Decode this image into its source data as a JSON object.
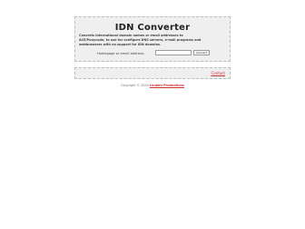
{
  "main": {
    "title": "IDN Converter",
    "description": "Converts international domain names or email addresses to\nACE/Punycode, to use for configure DNS servers, e-mail programs and\nwebbrowsers with no support for IDN domains.",
    "input_label": "Homepage or email address:",
    "input_value": "",
    "button_label": "Convert"
  },
  "footer": {
    "link_label": "Contact"
  },
  "copyright": {
    "prefix": "Copyright © 2004 ",
    "brand": "Lindahl Productions"
  }
}
